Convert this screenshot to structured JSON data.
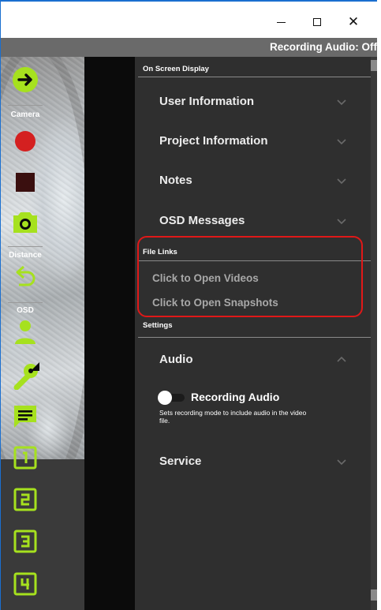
{
  "window": {
    "minimize_glyph": "–",
    "maximize_glyph": "☐",
    "close_glyph": "✕"
  },
  "status": {
    "recording_audio_text": "Recording Audio: Off"
  },
  "toolbar": {
    "camera_label": "Camera",
    "distance_label": "Distance",
    "osd_label": "OSD",
    "channels": [
      "1",
      "2",
      "3",
      "4"
    ],
    "accent_color": "#a6e11e",
    "record_color": "#d42020",
    "stop_color": "#3a0f0f"
  },
  "panel": {
    "on_screen_display": {
      "heading": "On Screen Display",
      "items": [
        {
          "label": "User Information"
        },
        {
          "label": "Project Information"
        },
        {
          "label": "Notes"
        },
        {
          "label": "OSD Messages"
        }
      ]
    },
    "file_links": {
      "heading": "File Links",
      "open_videos": "Click to Open Videos",
      "open_snapshots": "Click to Open Snapshots"
    },
    "settings": {
      "heading": "Settings",
      "audio": {
        "label": "Audio",
        "toggle_label": "Recording Audio",
        "toggle_on": false,
        "description": "Sets recording mode to include audio in the video file."
      },
      "service": {
        "label": "Service"
      }
    }
  }
}
